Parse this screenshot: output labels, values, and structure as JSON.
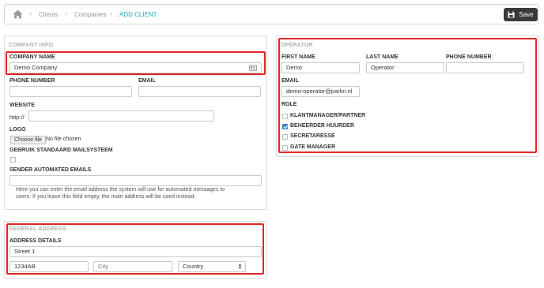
{
  "breadcrumb": {
    "items": [
      "Clients",
      "Companies"
    ],
    "active": "ADD CLIENT"
  },
  "toolbar": {
    "save_label": "Save"
  },
  "company_info": {
    "title": "COMPANY INFO",
    "company_name_label": "COMPANY NAME",
    "company_name_value": "Demo Company",
    "phone_label": "PHONE NUMBER",
    "email_label": "EMAIL",
    "website_label": "WEBSITE",
    "website_prefix": "http://",
    "logo_label": "LOGO",
    "choose_file_label": "Choose file",
    "no_file_text": "No file chosen",
    "mailsystem_label": "GEBRUIK STANDAARD MAILSYSTEEM",
    "sender_label": "SENDER AUTOMATED EMAILS",
    "sender_help": "Here you can enter the email address the system will use for automated messages to users. If you leave this field empty, the main address will be used instead."
  },
  "general_address": {
    "title": "GENERAL ADDRESS",
    "details_label": "ADDRESS DETAILS",
    "street_value": "Street 1",
    "postcode_value": "1234AB",
    "city_placeholder": "City",
    "country_value": "Country"
  },
  "operator": {
    "title": "OPERATOR",
    "first_name_label": "FIRST NAME",
    "first_name_value": "Demo",
    "last_name_label": "LAST NAME",
    "last_name_value": "Operator",
    "phone_label": "PHONE NUMBER",
    "email_label": "EMAIL",
    "email_value": "demo-operator@parkn.nl",
    "role_label": "ROLE",
    "roles": [
      {
        "label": "KLANTMANAGER/PARTNER",
        "checked": false
      },
      {
        "label": "BEHEERDER HUURDER",
        "checked": true
      },
      {
        "label": "SECRETARESSE",
        "checked": false
      },
      {
        "label": "GATE MANAGER",
        "checked": false
      }
    ]
  },
  "colors": {
    "accent": "#2aa6c6",
    "highlight": "#e02525",
    "save_bg": "#3a3a3a",
    "checkbox_on": "#4a90d9"
  },
  "icons": [
    "home-icon",
    "chevron-right-icon",
    "save-icon",
    "contact-card-icon",
    "select-arrows-icon"
  ]
}
